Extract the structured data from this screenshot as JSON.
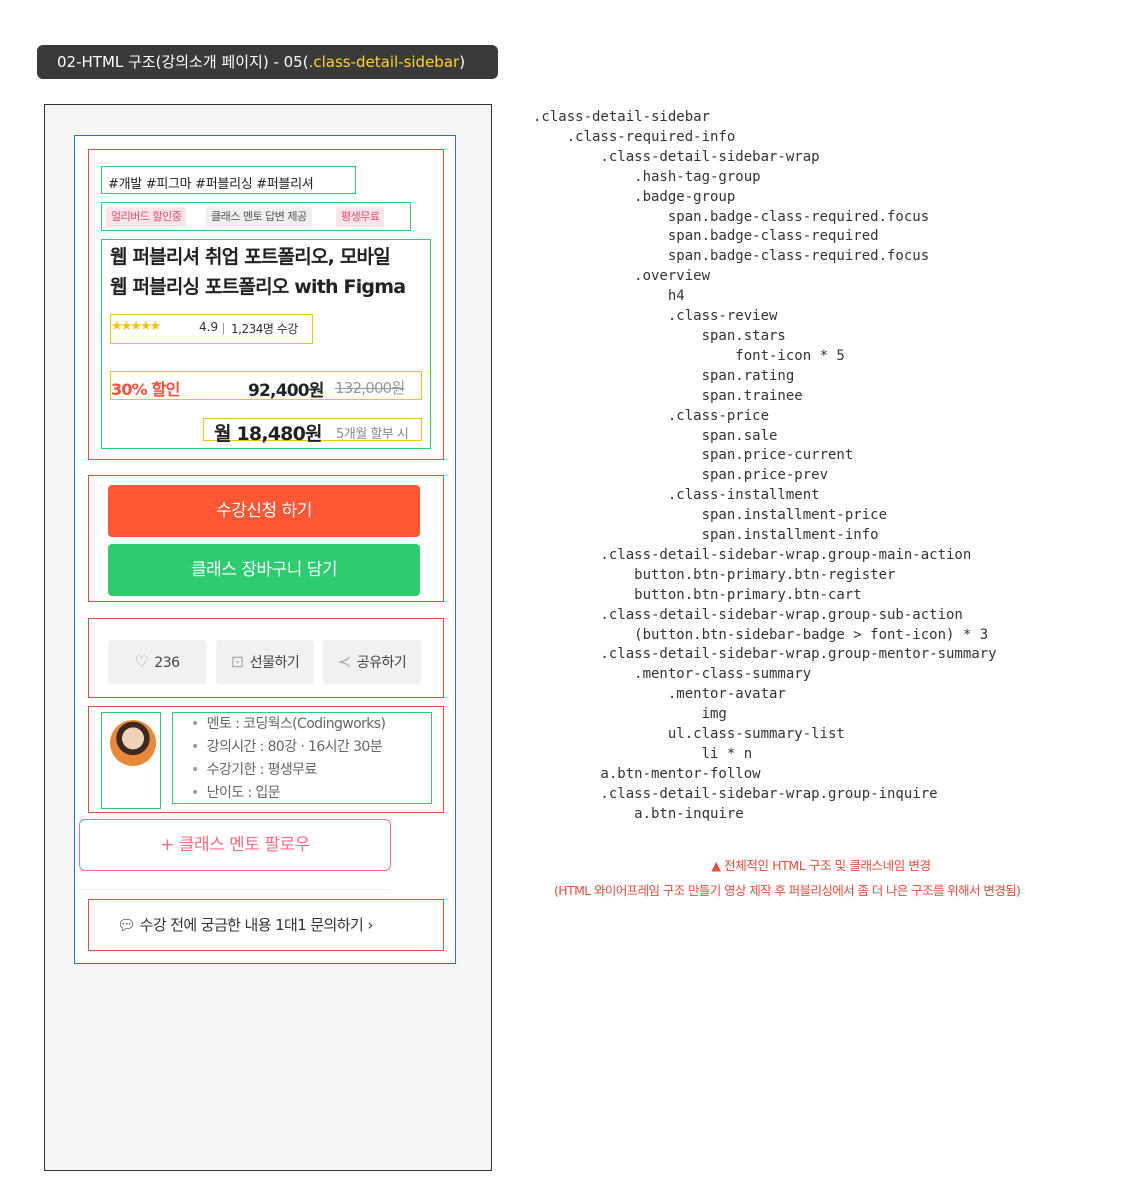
{
  "header": {
    "title_prefix": "02-HTML 구조(강의소개 페이지) - 05(",
    "title_highlight": ".class-detail-sidebar",
    "title_suffix": ")"
  },
  "sidebar": {
    "hash_tags": "#개발 #피그마 #퍼블리싱 #퍼블리셔",
    "badges": [
      "얼리버드 할인중",
      "클래스 멘토 답변 제공",
      "평생무료"
    ],
    "title_line1": "웹 퍼블리셔 취업 포트폴리오, 모바일",
    "title_line2": "웹 퍼블리싱 포트폴리오 with Figma",
    "stars": "★★★★★",
    "rating": "4.9",
    "trainee": "1,234명 수강",
    "sale": "30% 할인",
    "price_current": "92,400원",
    "price_prev": "132,000원",
    "installment_price": "월 18,480원",
    "installment_info": "5개월 할부 시",
    "btn_register": "수강신청 하기",
    "btn_cart": "클래스 장바구니 담기",
    "like_count": "236",
    "gift": "선물하기",
    "share": "공유하기",
    "summary": [
      "멘토 : 코딩웍스(Codingworks)",
      "강의시간 : 80강 · 16시간 30분",
      "수강기한 : 평생무료",
      "난이도 : 입문"
    ],
    "follow": "클래스 멘토 팔로우",
    "follow_icon": "+",
    "inquire": "수강 전에 궁금한 내용 1대1 문의하기",
    "colors": {
      "register": "#ff5733",
      "cart": "#2ecc71",
      "follow": "#ff6b86"
    }
  },
  "tree_text": ".class-detail-sidebar\n    .class-required-info\n        .class-detail-sidebar-wrap\n            .hash-tag-group\n            .badge-group\n                span.badge-class-required.focus\n                span.badge-class-required\n                span.badge-class-required.focus\n            .overview\n                h4\n                .class-review\n                    span.stars\n                        font-icon * 5\n                    span.rating\n                    span.trainee\n                .class-price\n                    span.sale\n                    span.price-current\n                    span.price-prev\n                .class-installment\n                    span.installment-price\n                    span.installment-info\n        .class-detail-sidebar-wrap.group-main-action\n            button.btn-primary.btn-register\n            button.btn-primary.btn-cart\n        .class-detail-sidebar-wrap.group-sub-action\n            (button.btn-sidebar-badge > font-icon) * 3\n        .class-detail-sidebar-wrap.group-mentor-summary\n            .mentor-class-summary\n                .mentor-avatar\n                    img\n                ul.class-summary-list\n                    li * n\n        a.btn-mentor-follow\n        .class-detail-sidebar-wrap.group-inquire\n            a.btn-inquire",
  "notes": {
    "line1": "▲ 전체적인 HTML 구조 및 클래스네임 변경",
    "line2": "(HTML 와이어프레임 구조 만들기 영상 제작 후 퍼블리싱에서 좀 더 나은 구조를 위해서 변경됨)"
  }
}
